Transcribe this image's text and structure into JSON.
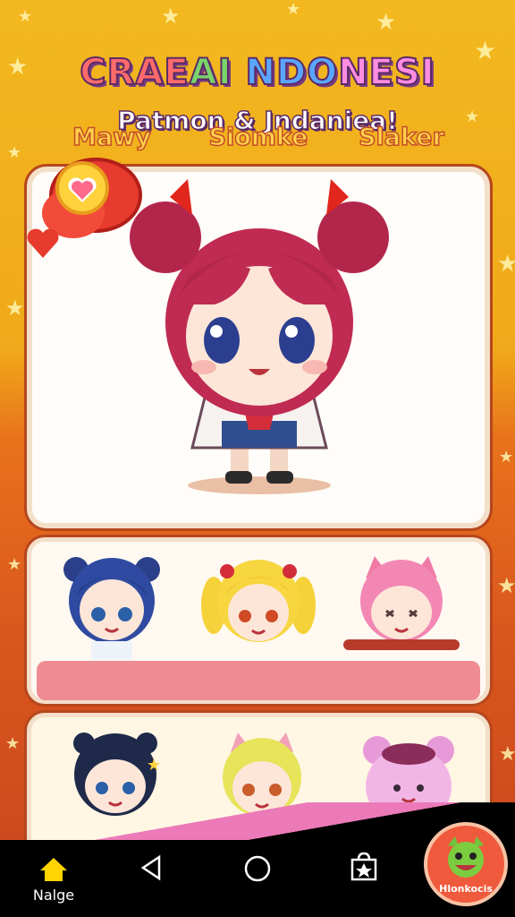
{
  "header": {
    "title": "CRAEAI NDONESI",
    "title_parts": [
      "CRAE",
      "AI ",
      "NDO",
      "NESI"
    ],
    "subtitle": "Patmon & Jndaniea!"
  },
  "featured": {
    "badge_icon": "heart-bubble-icon"
  },
  "characters_row1": [
    {
      "name": "Mawy"
    },
    {
      "name": "Siomke"
    },
    {
      "name": "Slaker"
    }
  ],
  "characters_row2_count": 3,
  "nav": {
    "home_label": "Nalge",
    "back_icon": "back-triangle-icon",
    "home_circle_icon": "home-circle-icon",
    "bag_icon": "shopping-bag-icon",
    "app_badge_label": "Hlonkocis"
  },
  "colors": {
    "background_top": "#f3b81f",
    "background_bottom": "#c9451e",
    "card": "#fffdf9",
    "name_band": "#ef8c93",
    "name_text": "#ffd14a",
    "nav": "#000000"
  }
}
